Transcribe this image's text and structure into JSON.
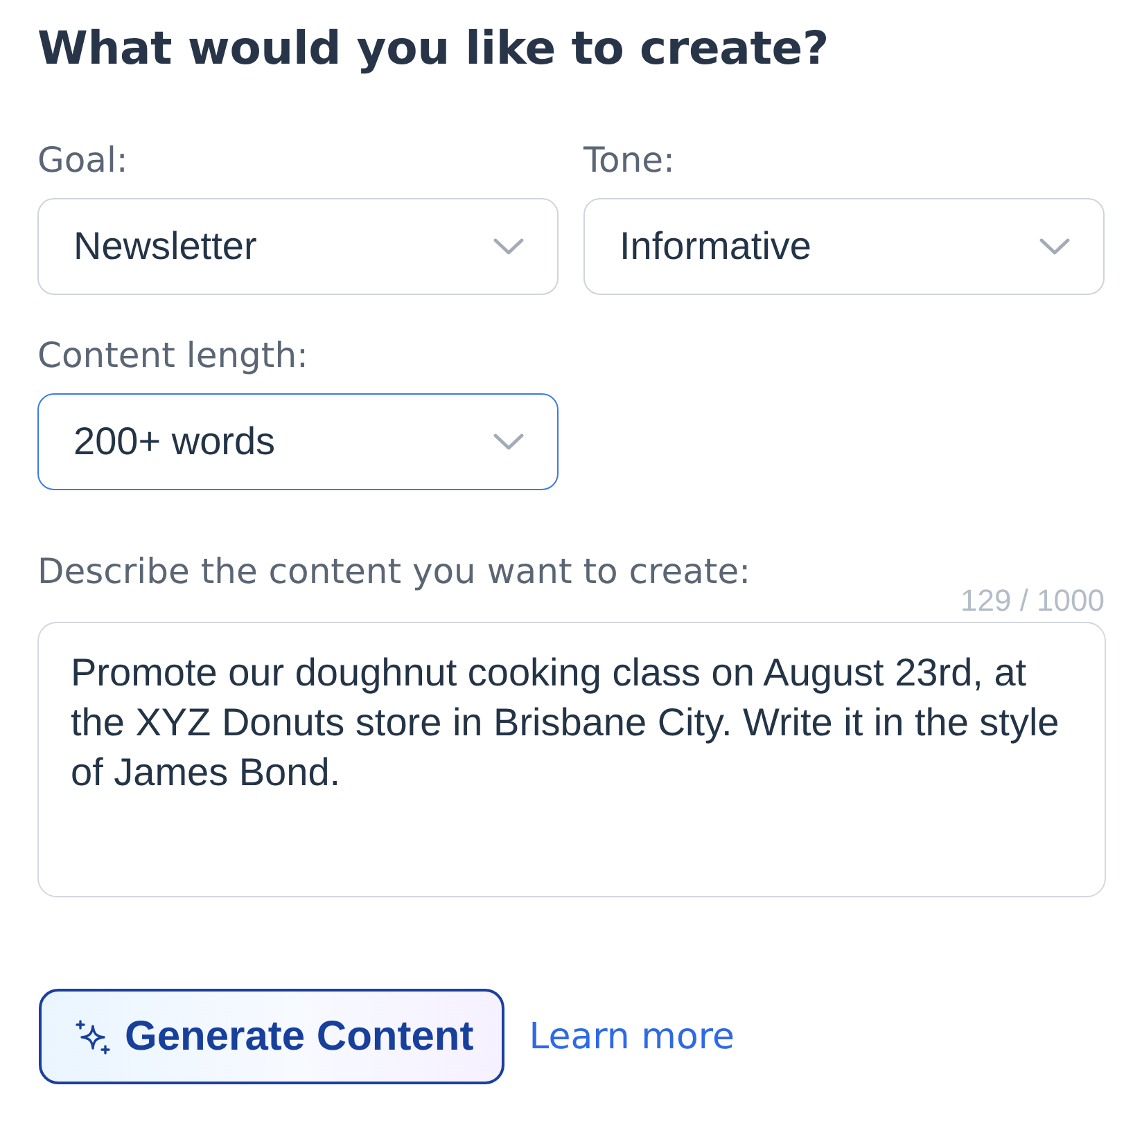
{
  "heading": "What would you like to create?",
  "fields": [
    {
      "kind": "select",
      "label": "Goal:",
      "value": "Newsletter",
      "focused": false
    },
    {
      "kind": "select",
      "label": "Tone:",
      "value": "Informative",
      "focused": false
    },
    {
      "kind": "select",
      "label": "Content length:",
      "value": "200+ words",
      "focused": true
    }
  ],
  "description": {
    "label": "Describe the content you want to create:",
    "counter": "129 / 1000",
    "value": "Promote our doughnut cooking class on August 23rd, at the XYZ Donuts store in Brisbane City. Write it in the style of James Bond."
  },
  "actions": {
    "generate_button": "Generate Content",
    "learn_more_link": "Learn more"
  }
}
